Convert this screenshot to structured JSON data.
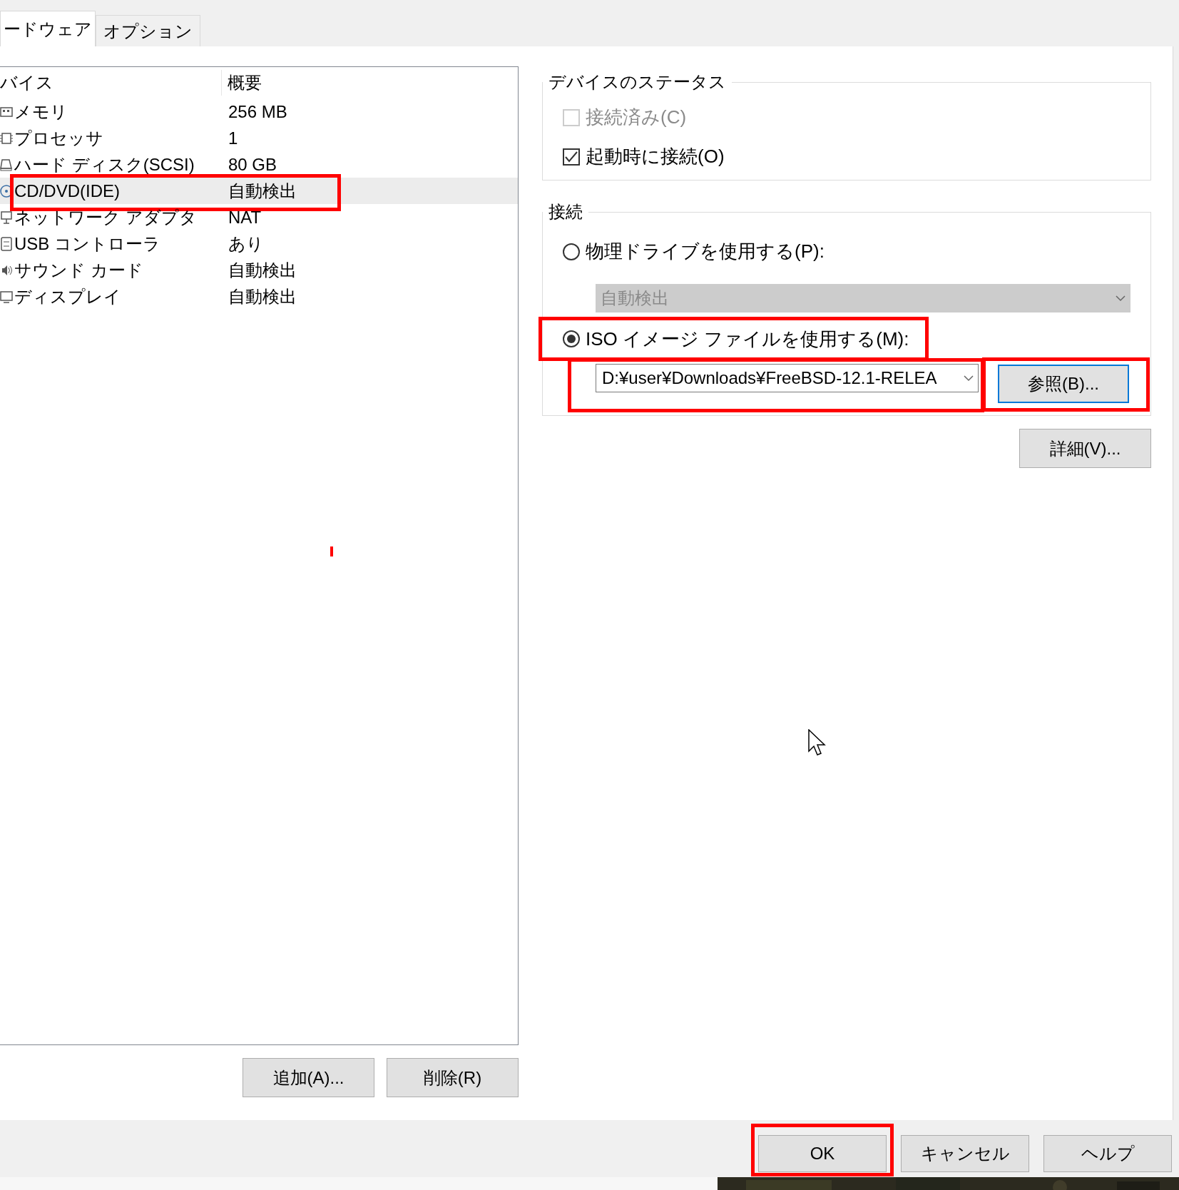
{
  "tabs": [
    {
      "label": "ードウェア",
      "selected": true
    },
    {
      "label": "オプション",
      "selected": false
    }
  ],
  "device_list": {
    "columns": [
      "バイス",
      "概要"
    ],
    "rows": [
      {
        "device": "メモリ",
        "summary": "256 MB",
        "selected": false,
        "highlighted": false
      },
      {
        "device": "プロセッサ",
        "summary": "1",
        "selected": false,
        "highlighted": false
      },
      {
        "device": "ハード ディスク(SCSI)",
        "summary": "80 GB",
        "selected": false,
        "highlighted": false
      },
      {
        "device": "CD/DVD(IDE)",
        "summary": "自動検出",
        "selected": true,
        "highlighted": true
      },
      {
        "device": "ネットワーク アダプタ",
        "summary": "NAT",
        "selected": false,
        "highlighted": false
      },
      {
        "device": "USB コントローラ",
        "summary": "あり",
        "selected": false,
        "highlighted": false
      },
      {
        "device": "サウンド カード",
        "summary": "自動検出",
        "selected": false,
        "highlighted": false
      },
      {
        "device": "ディスプレイ",
        "summary": "自動検出",
        "selected": false,
        "highlighted": false
      }
    ]
  },
  "list_buttons": [
    "追加(A)...",
    "削除(R)"
  ],
  "device_status": {
    "title": "デバイスのステータス",
    "options": [
      {
        "label": "接続済み(C)",
        "checked": false,
        "disabled": true
      },
      {
        "label": "起動時に接続(O)",
        "checked": true,
        "disabled": false
      }
    ]
  },
  "connection": {
    "title": "接続",
    "physical": {
      "label": "物理ドライブを使用する(P):",
      "selected": false,
      "highlighted": false,
      "drive": {
        "value": "自動検出",
        "disabled": true
      }
    },
    "iso": {
      "label": "ISO イメージ ファイルを使用する(M):",
      "selected": true,
      "highlighted": true,
      "path": {
        "value": "D:¥user¥Downloads¥FreeBSD-12.1-RELEA",
        "highlighted": true
      },
      "browse": {
        "label": "参照(B)...",
        "highlighted": true
      }
    }
  },
  "advanced_button": "詳細(V)...",
  "dialog_buttons": [
    {
      "label": "OK",
      "highlighted": true
    },
    {
      "label": "キャンセル",
      "highlighted": false
    },
    {
      "label": "ヘルプ",
      "highlighted": false
    }
  ]
}
